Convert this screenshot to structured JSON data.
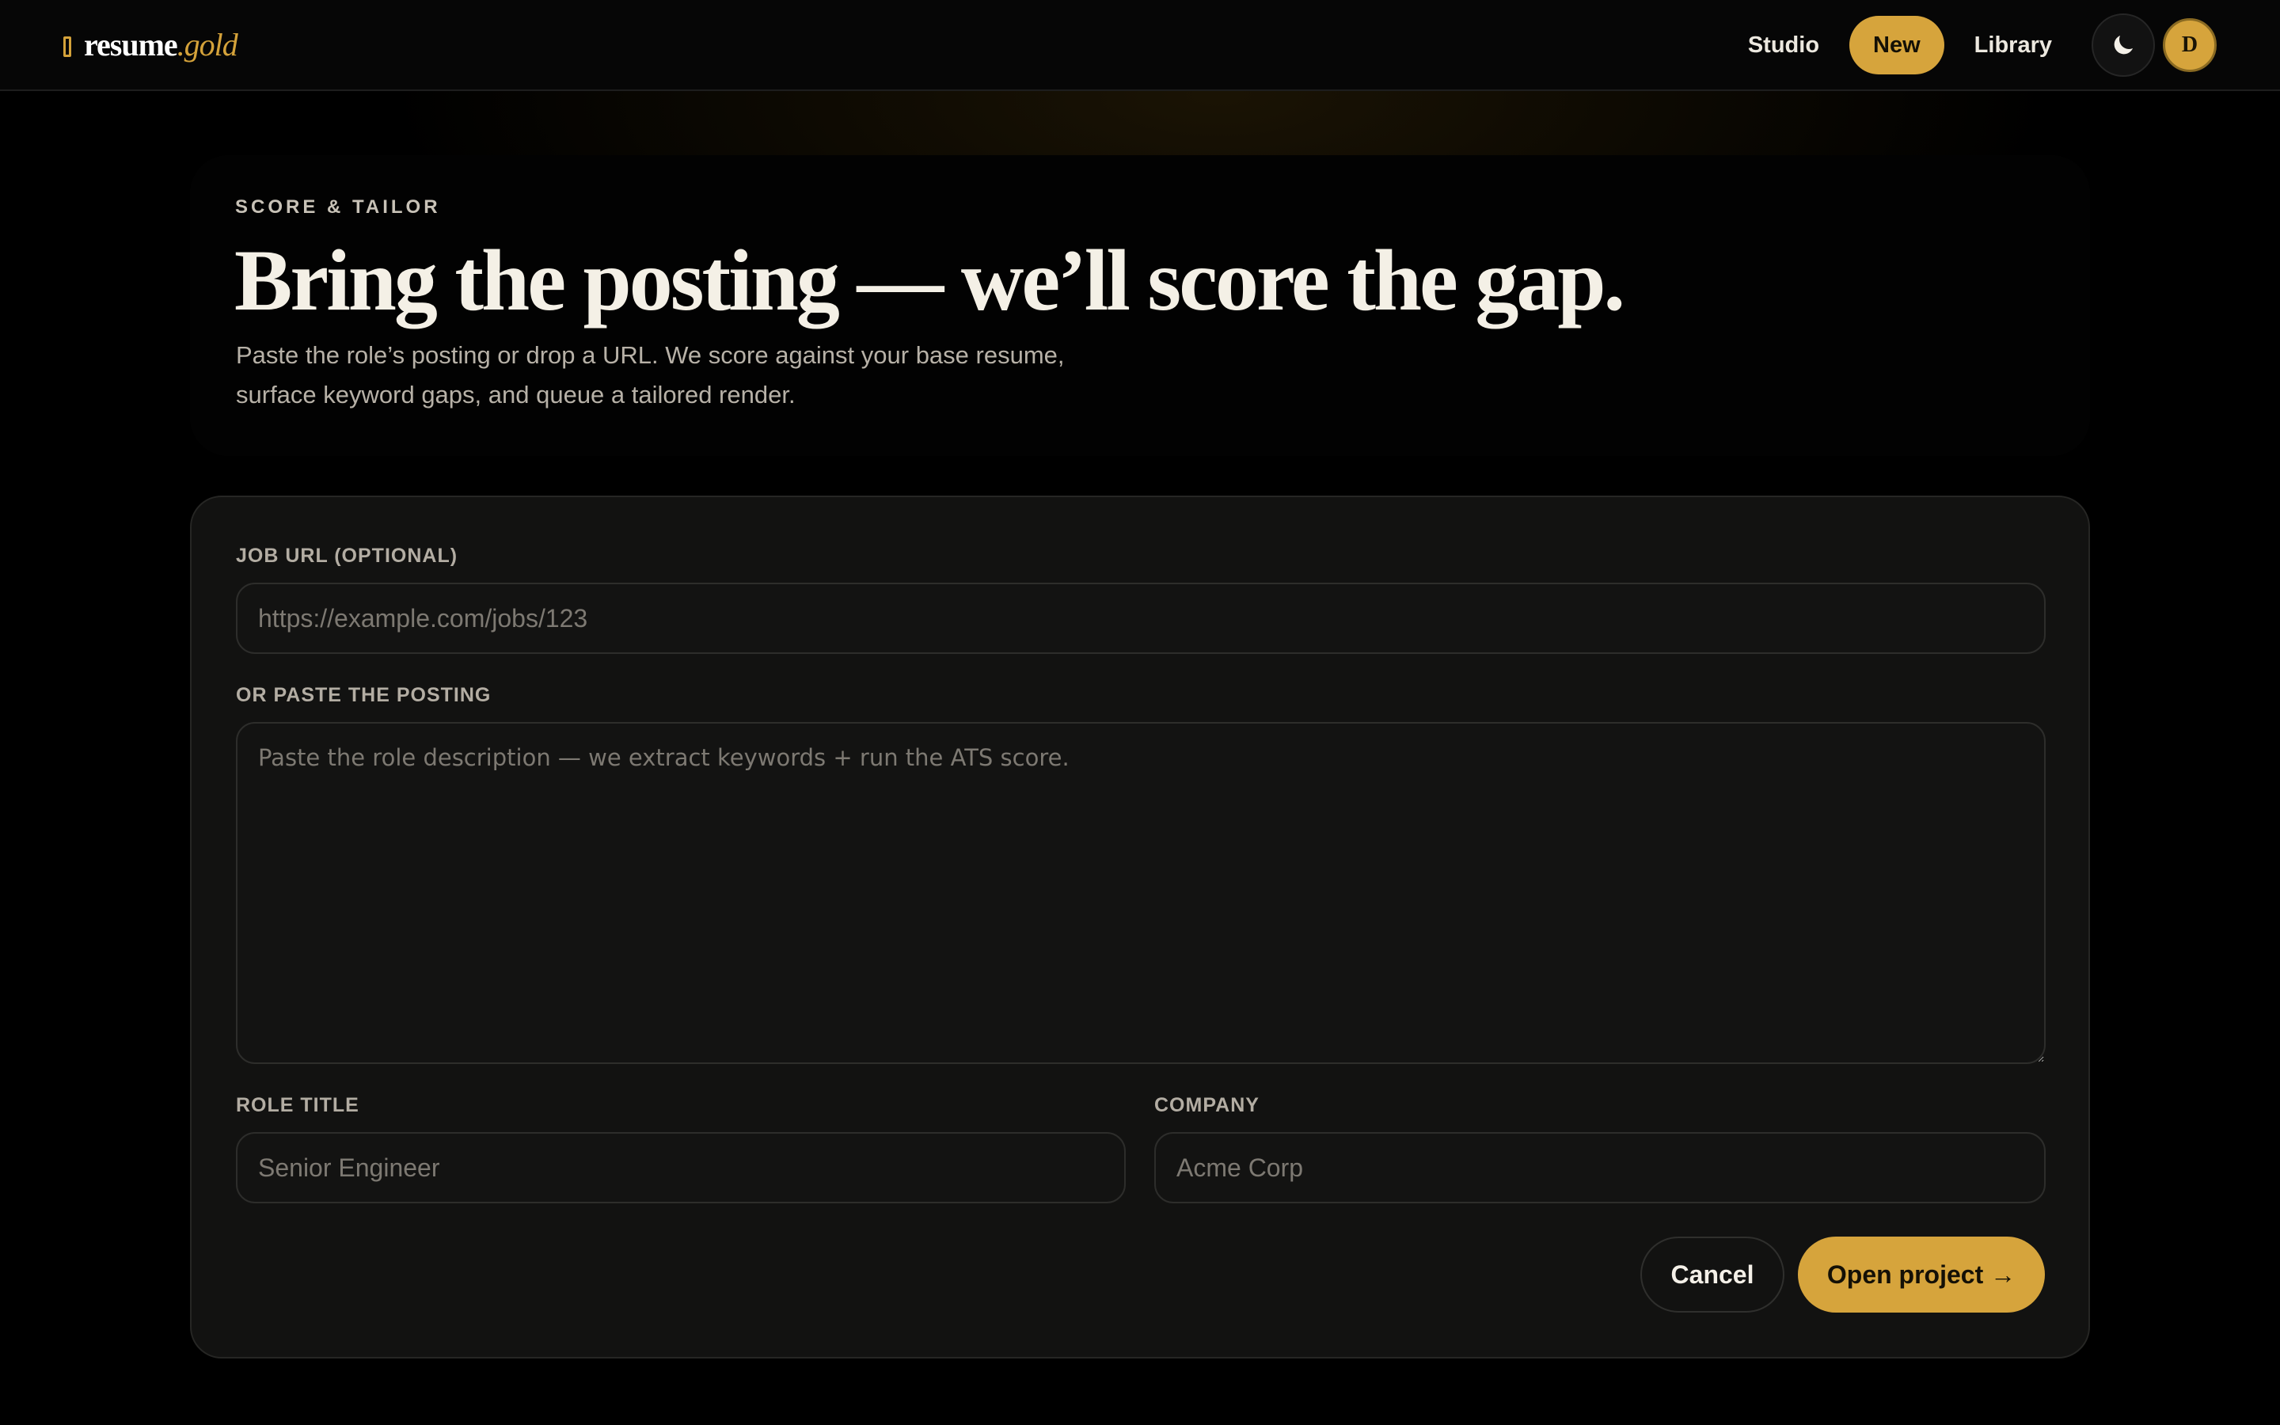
{
  "brand": {
    "name_main": "resume",
    "name_accent": ".gold",
    "icon": "bookmark-icon",
    "accent_color": "#d6a43c"
  },
  "nav": {
    "items": [
      {
        "label": "Studio",
        "active": false
      },
      {
        "label": "New",
        "active": true
      },
      {
        "label": "Library",
        "active": false
      }
    ],
    "theme_toggle_icon": "moon-icon",
    "avatar_initial": "D"
  },
  "hero": {
    "eyebrow": "SCORE & TAILOR",
    "headline": "Bring the posting — we’ll score the gap.",
    "subtext": "Paste the role’s posting or drop a URL. We score against your base resume, surface keyword gaps, and queue a tailored render."
  },
  "form": {
    "job_url": {
      "label": "JOB URL (OPTIONAL)",
      "value": "",
      "placeholder": "https://example.com/jobs/123"
    },
    "posting": {
      "label": "OR PASTE THE POSTING",
      "value": "",
      "placeholder": "Paste the role description — we extract keywords + run the ATS score."
    },
    "role_title": {
      "label": "ROLE TITLE",
      "value": "",
      "placeholder": "Senior Engineer"
    },
    "company": {
      "label": "COMPANY",
      "value": "",
      "placeholder": "Acme Corp"
    },
    "cancel_label": "Cancel",
    "submit_label": "Open project →"
  }
}
